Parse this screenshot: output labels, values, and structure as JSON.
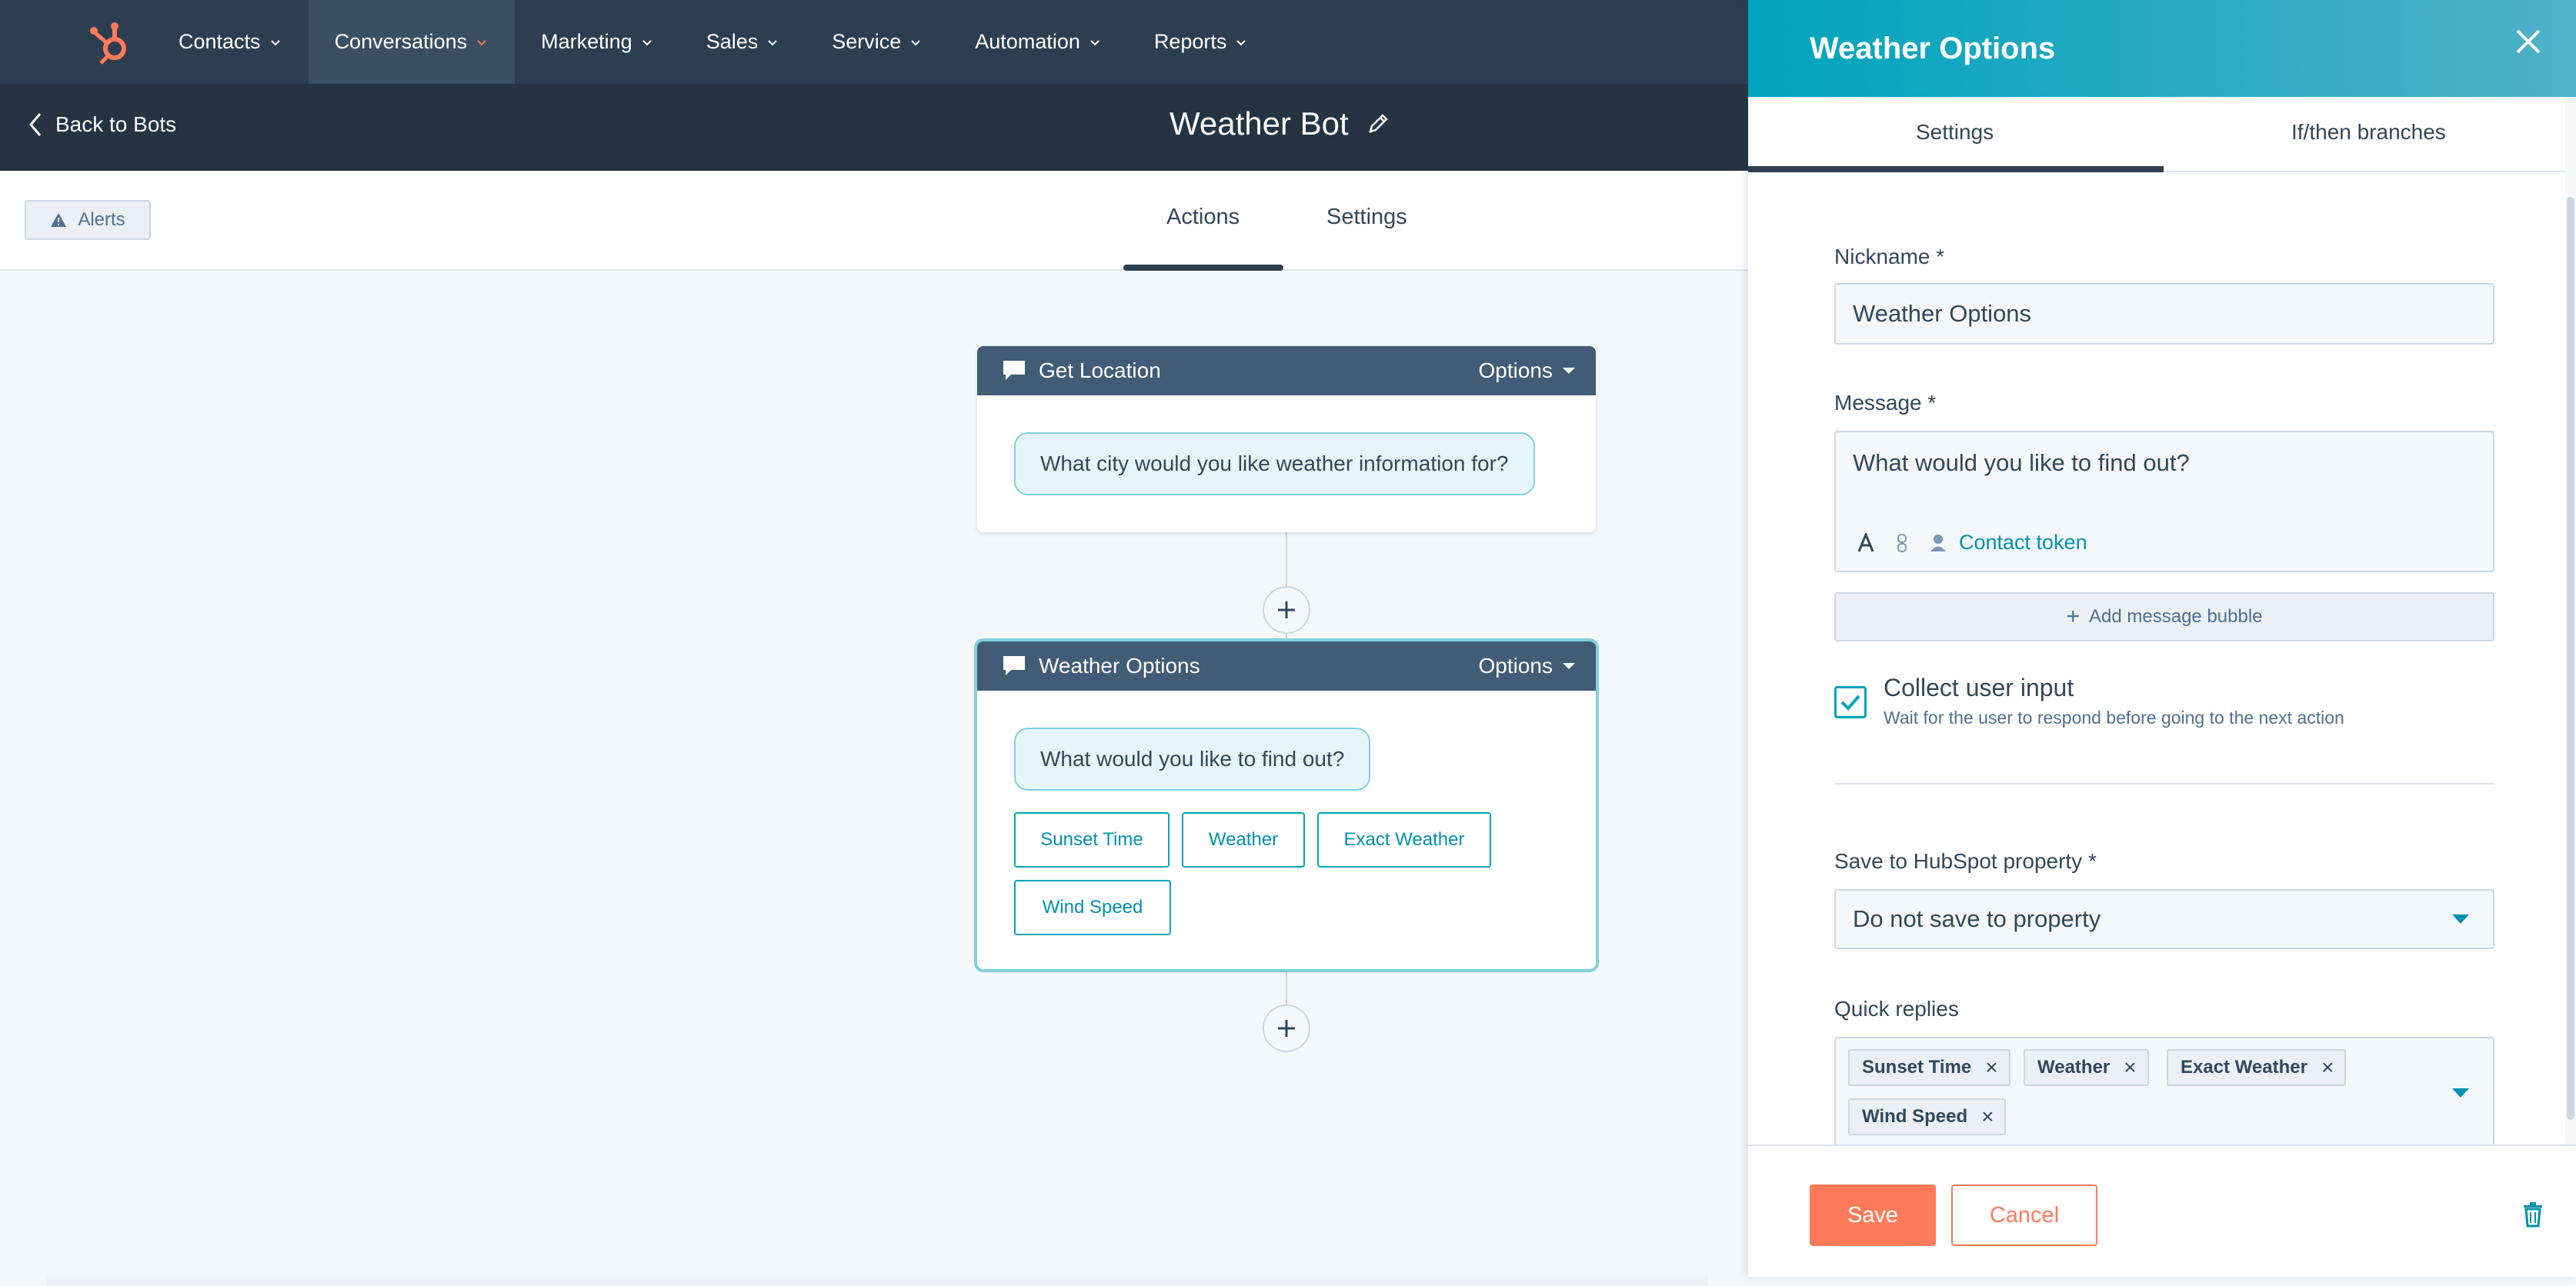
{
  "colors": {
    "nav_bg": "#2d3e50",
    "subheader_bg": "#253342",
    "accent_teal": "#00a4bd",
    "link_teal": "#0091ae",
    "primary_orange": "#ff7a59",
    "logo_orange": "#ff7a59"
  },
  "topnav": {
    "logo_icon": "hubspot-sprocket-icon",
    "items": [
      {
        "label": "Contacts"
      },
      {
        "label": "Conversations",
        "active": true
      },
      {
        "label": "Marketing"
      },
      {
        "label": "Sales"
      },
      {
        "label": "Service"
      },
      {
        "label": "Automation"
      },
      {
        "label": "Reports"
      }
    ]
  },
  "subheader": {
    "back_label": "Back to Bots",
    "title": "Weather Bot"
  },
  "tabsbar": {
    "alerts_label": "Alerts",
    "tabs": [
      {
        "label": "Actions",
        "active": true
      },
      {
        "label": "Settings"
      }
    ]
  },
  "canvas": {
    "cards": [
      {
        "title": "Get Location",
        "options_label": "Options",
        "message": "What city would you like weather information for?"
      },
      {
        "title": "Weather Options",
        "options_label": "Options",
        "message": "What would you like to find out?",
        "quick_replies": [
          "Sunset Time",
          "Weather",
          "Exact Weather",
          "Wind Speed"
        ]
      }
    ]
  },
  "panel": {
    "title": "Weather Options",
    "tabs": [
      {
        "label": "Settings",
        "active": true
      },
      {
        "label": "If/then branches"
      }
    ],
    "nickname": {
      "label": "Nickname *",
      "value": "Weather Options"
    },
    "message": {
      "label": "Message *",
      "value": "What would you like to find out?",
      "token_label": "Contact token",
      "add_bubble_label": "Add message bubble"
    },
    "collect_input": {
      "checked": true,
      "title": "Collect user input",
      "subtitle": "Wait for the user to respond before going to the next action"
    },
    "save_property": {
      "label": "Save to HubSpot property *",
      "value": "Do not save to property"
    },
    "quick_replies": {
      "label": "Quick replies",
      "tags": [
        "Sunset Time",
        "Weather",
        "Exact Weather",
        "Wind Speed"
      ]
    },
    "footer": {
      "save_label": "Save",
      "cancel_label": "Cancel"
    }
  }
}
